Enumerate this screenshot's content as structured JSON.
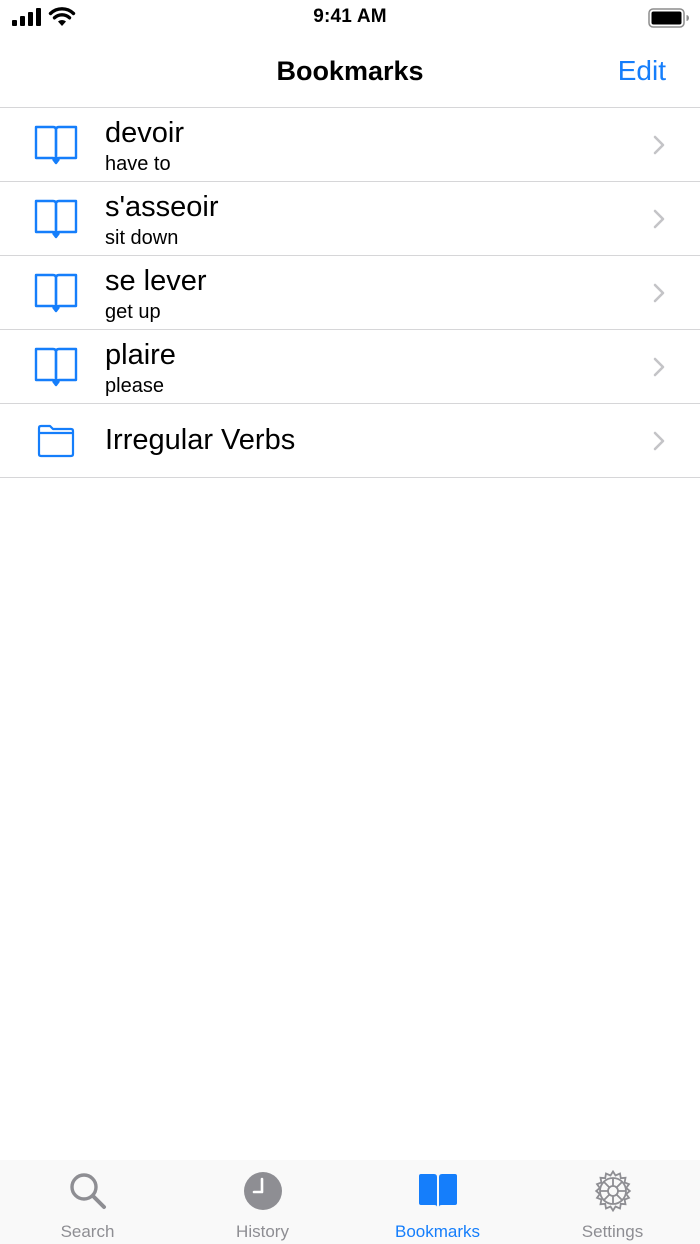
{
  "status_bar": {
    "time": "9:41 AM"
  },
  "nav": {
    "title": "Bookmarks",
    "edit_label": "Edit"
  },
  "list": {
    "items": [
      {
        "type": "bookmark",
        "icon": "book-icon",
        "title": "devoir",
        "subtitle": "have to"
      },
      {
        "type": "bookmark",
        "icon": "book-icon",
        "title": "s'asseoir",
        "subtitle": "sit down"
      },
      {
        "type": "bookmark",
        "icon": "book-icon",
        "title": "se lever",
        "subtitle": "get up"
      },
      {
        "type": "bookmark",
        "icon": "book-icon",
        "title": "plaire",
        "subtitle": "please"
      },
      {
        "type": "folder",
        "icon": "folder-icon",
        "title": "Irregular Verbs"
      }
    ]
  },
  "tab_bar": {
    "tabs": [
      {
        "label": "Search",
        "icon": "magnifier-icon",
        "active": false
      },
      {
        "label": "History",
        "icon": "clock-icon",
        "active": false
      },
      {
        "label": "Bookmarks",
        "icon": "book-icon",
        "active": true
      },
      {
        "label": "Settings",
        "icon": "gear-icon",
        "active": false
      }
    ]
  },
  "colors": {
    "accent": "#157efb",
    "inactive": "#8e8e93",
    "separator": "#d6d6d8",
    "chevron": "#c4c4c7"
  }
}
